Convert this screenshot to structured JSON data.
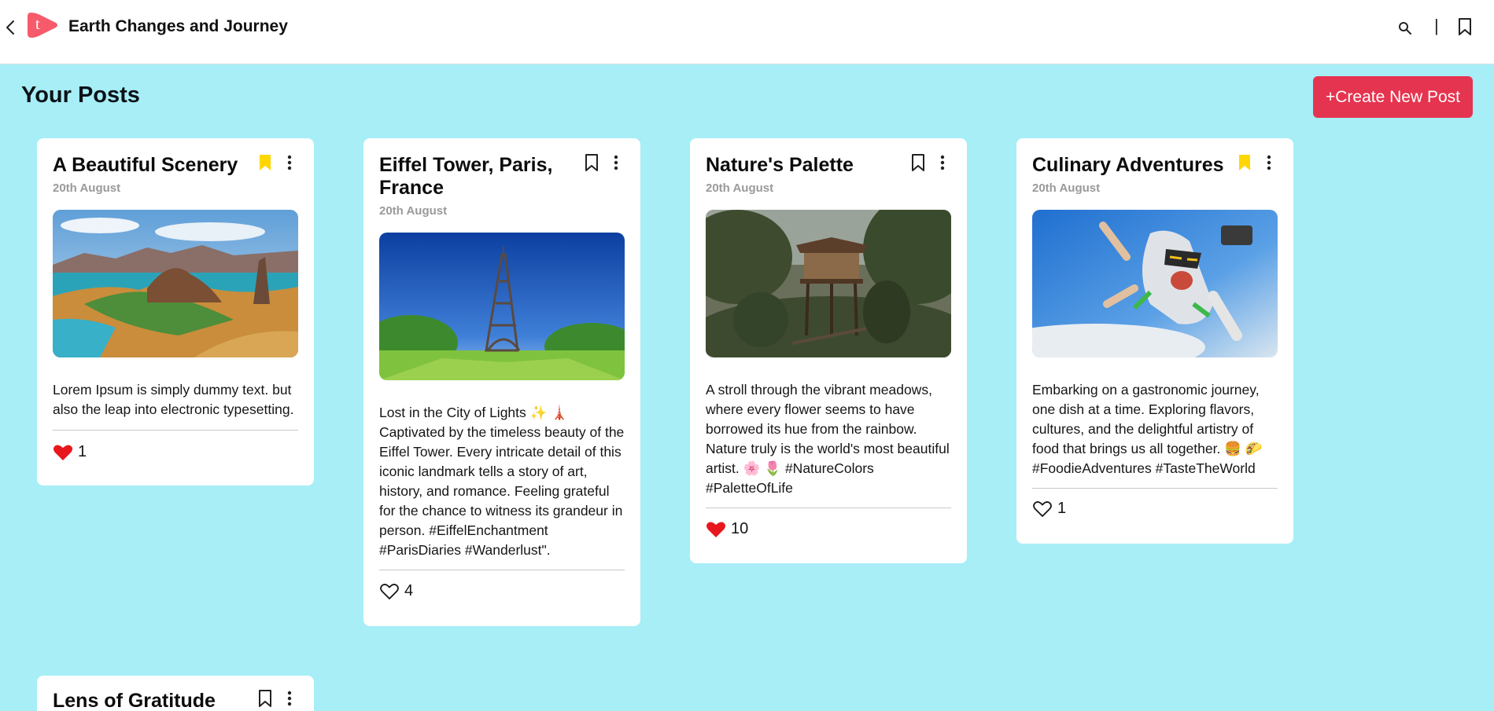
{
  "header": {
    "logo_letter": "t",
    "title": "Earth Changes and Journey",
    "divider": "|"
  },
  "main": {
    "title": "Your Posts",
    "create_label": "+Create New Post"
  },
  "colors": {
    "page_bg": "#a7eef7",
    "accent": "#e5344f",
    "bookmark_active": "#ffd700",
    "like_active": "#e8161d"
  },
  "posts": [
    {
      "title": "A Beautiful Scenery",
      "date": "20th August",
      "bookmarked": true,
      "image": "island-landscape",
      "text": "Lorem Ipsum is simply dummy text. but also the leap into electronic typesetting.",
      "liked": true,
      "likes": "1"
    },
    {
      "title": "Eiffel Tower, Paris, France",
      "date": "20th August",
      "bookmarked": false,
      "image": "eiffel-tower",
      "text": "Lost in the City of Lights ✨ 🗼 Captivated by the timeless beauty of the Eiffel Tower. Every intricate detail of this iconic landmark tells a story of art, history, and romance. Feeling grateful for the chance to witness its grandeur in person. #EiffelEnchantment #ParisDiaries #Wanderlust\".",
      "liked": false,
      "likes": "4"
    },
    {
      "title": "Nature's Palette",
      "date": "20th August",
      "bookmarked": false,
      "image": "treehouse-forest",
      "text": "A stroll through the vibrant meadows, where every flower seems to have borrowed its hue from the rainbow. Nature truly is the world's most beautiful artist. 🌸 🌷 #NatureColors #PaletteOfLife",
      "liked": true,
      "likes": "10"
    },
    {
      "title": "Culinary Adventures",
      "date": "20th August",
      "bookmarked": true,
      "image": "skydiver",
      "text": "Embarking on a gastronomic journey, one dish at a time. Exploring flavors, cultures, and the delightful artistry of food that brings us all together. 🍔 🌮 #FoodieAdventures #TasteTheWorld",
      "liked": false,
      "likes": "1"
    },
    {
      "title": "Lens of Gratitude",
      "bookmarked": false
    }
  ]
}
